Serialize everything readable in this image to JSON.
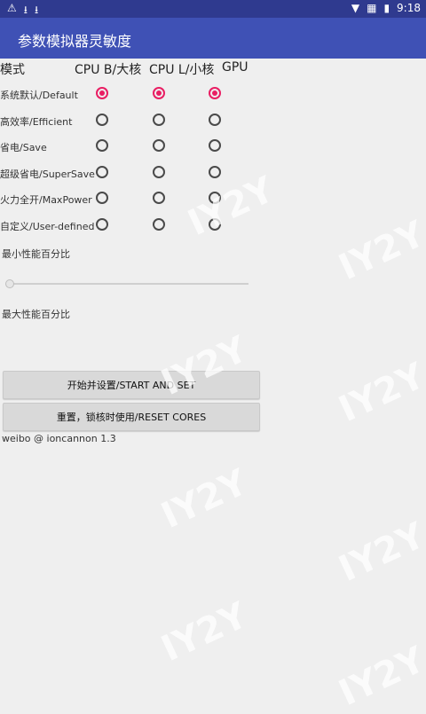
{
  "status_bar": {
    "left_icons": [
      "warning-icon",
      "download-icon",
      "download-icon"
    ],
    "time": "9:18"
  },
  "toolbar": {
    "title": "参数模拟器灵敏度"
  },
  "columns": {
    "mode": "模式",
    "cpu_b": "CPU B/大核",
    "cpu_l": "CPU L/小核",
    "gpu": "GPU"
  },
  "rows": [
    {
      "label": "系统默认/Default",
      "cpu_b": true,
      "cpu_l": true,
      "gpu": true
    },
    {
      "label": "高效率/Efficient",
      "cpu_b": false,
      "cpu_l": false,
      "gpu": false
    },
    {
      "label": "省电/Save",
      "cpu_b": false,
      "cpu_l": false,
      "gpu": false
    },
    {
      "label": "超级省电/SuperSave",
      "cpu_b": false,
      "cpu_l": false,
      "gpu": false
    },
    {
      "label": "火力全开/MaxPower",
      "cpu_b": false,
      "cpu_l": false,
      "gpu": false
    },
    {
      "label": "自定义/User-defined",
      "cpu_b": false,
      "cpu_l": false,
      "gpu": false
    }
  ],
  "min_perf": {
    "label": "最小性能百分比",
    "value": 0
  },
  "max_perf": {
    "label": "最大性能百分比"
  },
  "buttons": {
    "start": "开始并设置/START AND SET",
    "reset": "重置，锁核时使用/RESET CORES"
  },
  "footer": "weibo @ ioncannon 1.3",
  "colors": {
    "primary": "#3f51b5",
    "status": "#2f3a8f",
    "accent": "#e91e63",
    "bg": "#efefef"
  }
}
